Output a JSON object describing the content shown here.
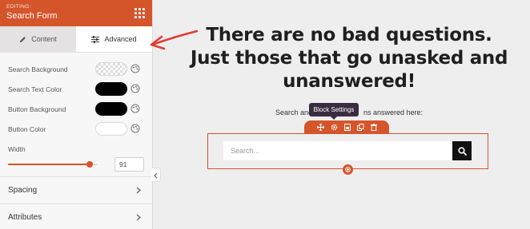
{
  "sidebar": {
    "eyebrow": "EDITING:",
    "title": "Search Form",
    "tabs": [
      {
        "label": "Content",
        "icon": "pencil-icon",
        "active": false
      },
      {
        "label": "Advanced",
        "icon": "sliders-icon",
        "active": true
      }
    ],
    "properties": [
      {
        "label": "Search Background",
        "swatch": "transparent"
      },
      {
        "label": "Search Text Color",
        "swatch": "#000000"
      },
      {
        "label": "Button Background",
        "swatch": "#000000"
      },
      {
        "label": "Button Color",
        "swatch": "#ffffff"
      }
    ],
    "width": {
      "label": "Width",
      "value": "91",
      "level_percent": 91
    },
    "sections": [
      {
        "label": "Spacing"
      },
      {
        "label": "Attributes"
      }
    ]
  },
  "canvas": {
    "headline_lines": [
      "There are no bad questions.",
      "Just those that go unasked and",
      "unanswered!"
    ],
    "sub_left": "Search and",
    "sub_right": "ns answered here:",
    "tooltip": "Block Settings",
    "toolbar_icons": [
      "move-icon",
      "gear-icon",
      "save-icon",
      "duplicate-icon",
      "trash-icon"
    ],
    "search_placeholder": "Search..."
  },
  "colors": {
    "accent": "#d5552a",
    "tooltip_bg": "#3a2c41"
  }
}
